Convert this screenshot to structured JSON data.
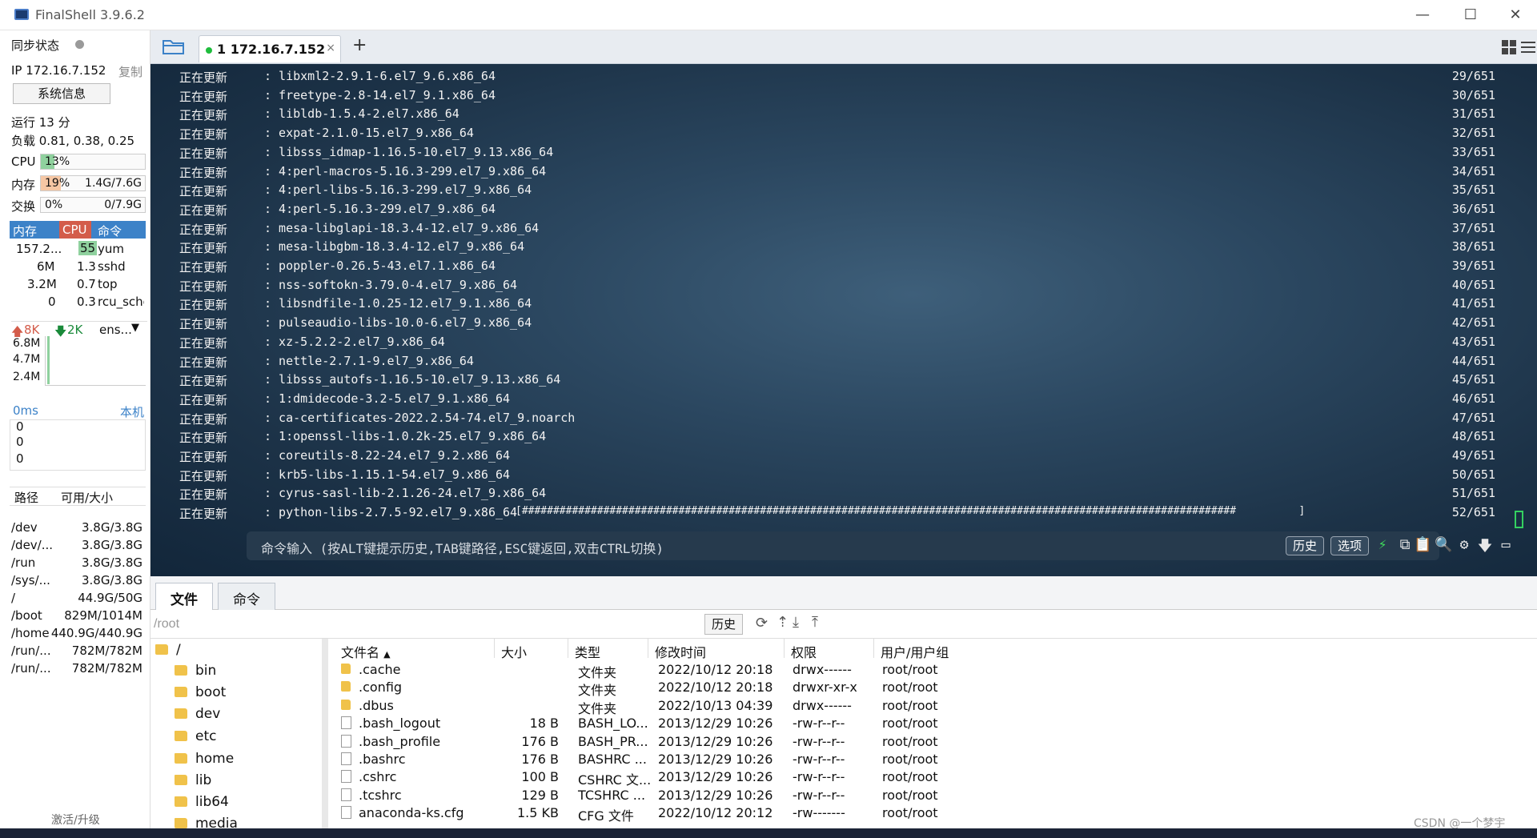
{
  "window": {
    "title": "FinalShell 3.9.6.2",
    "minimize": "—",
    "maximize": "☐",
    "close": "✕"
  },
  "sidebar": {
    "sync_label": "同步状态",
    "ip_label": "IP 172.16.7.152",
    "copy_label": "复制",
    "sysinfo_button": "系统信息",
    "uptime": "运行 13 分",
    "load": "负载 0.81, 0.38, 0.25",
    "cpu": {
      "label": "CPU",
      "value": "13%",
      "percent": 13
    },
    "mem": {
      "label": "内存",
      "value": "19%",
      "percent": 19,
      "amount": "1.4G/7.6G"
    },
    "swap": {
      "label": "交换",
      "value": "0%",
      "percent": 0,
      "amount": "0/7.9G"
    },
    "proc_headers": [
      "内存",
      "CPU",
      "命令"
    ],
    "procs": [
      {
        "mem": "157.2...",
        "cpu": "55",
        "cmd": "yum"
      },
      {
        "mem": "6M",
        "cpu": "1.3",
        "cmd": "sshd"
      },
      {
        "mem": "3.2M",
        "cpu": "0.7",
        "cmd": "top"
      },
      {
        "mem": "0",
        "cpu": "0.3",
        "cmd": "rcu_sche"
      }
    ],
    "net": {
      "up": "8K",
      "down": "2K",
      "iface": "ens...",
      "scale": [
        "6.8M",
        "4.7M",
        "2.4M"
      ]
    },
    "ping": {
      "latency": "0ms",
      "host": "本机",
      "values": [
        "0",
        "0",
        "0"
      ]
    },
    "disk_headers": [
      "路径",
      "可用/大小"
    ],
    "disks": [
      {
        "path": "/dev",
        "size": "3.8G/3.8G"
      },
      {
        "path": "/dev/...",
        "size": "3.8G/3.8G"
      },
      {
        "path": "/run",
        "size": "3.8G/3.8G"
      },
      {
        "path": "/sys/...",
        "size": "3.8G/3.8G"
      },
      {
        "path": "/",
        "size": "44.9G/50G"
      },
      {
        "path": "/boot",
        "size": "829M/1014M"
      },
      {
        "path": "/home",
        "size": "440.9G/440.9G"
      },
      {
        "path": "/run/...",
        "size": "782M/782M"
      },
      {
        "path": "/run/...",
        "size": "782M/782M"
      }
    ],
    "activate": "激活/升级"
  },
  "tabs": {
    "active_label": "1 172.16.7.152",
    "close": "×",
    "add": "+"
  },
  "terminal": {
    "lines": [
      {
        "status": "正在更新",
        "pkg": ": libxml2-2.9.1-6.el7_9.6.x86_64",
        "progress": "29/651"
      },
      {
        "status": "正在更新",
        "pkg": ": freetype-2.8-14.el7_9.1.x86_64",
        "progress": "30/651"
      },
      {
        "status": "正在更新",
        "pkg": ": libldb-1.5.4-2.el7.x86_64",
        "progress": "31/651"
      },
      {
        "status": "正在更新",
        "pkg": ": expat-2.1.0-15.el7_9.x86_64",
        "progress": "32/651"
      },
      {
        "status": "正在更新",
        "pkg": ": libsss_idmap-1.16.5-10.el7_9.13.x86_64",
        "progress": "33/651"
      },
      {
        "status": "正在更新",
        "pkg": ": 4:perl-macros-5.16.3-299.el7_9.x86_64",
        "progress": "34/651"
      },
      {
        "status": "正在更新",
        "pkg": ": 4:perl-libs-5.16.3-299.el7_9.x86_64",
        "progress": "35/651"
      },
      {
        "status": "正在更新",
        "pkg": ": 4:perl-5.16.3-299.el7_9.x86_64",
        "progress": "36/651"
      },
      {
        "status": "正在更新",
        "pkg": ": mesa-libglapi-18.3.4-12.el7_9.x86_64",
        "progress": "37/651"
      },
      {
        "status": "正在更新",
        "pkg": ": mesa-libgbm-18.3.4-12.el7_9.x86_64",
        "progress": "38/651"
      },
      {
        "status": "正在更新",
        "pkg": ": poppler-0.26.5-43.el7.1.x86_64",
        "progress": "39/651"
      },
      {
        "status": "正在更新",
        "pkg": ": nss-softokn-3.79.0-4.el7_9.x86_64",
        "progress": "40/651"
      },
      {
        "status": "正在更新",
        "pkg": ": libsndfile-1.0.25-12.el7_9.1.x86_64",
        "progress": "41/651"
      },
      {
        "status": "正在更新",
        "pkg": ": pulseaudio-libs-10.0-6.el7_9.x86_64",
        "progress": "42/651"
      },
      {
        "status": "正在更新",
        "pkg": ": xz-5.2.2-2.el7_9.x86_64",
        "progress": "43/651"
      },
      {
        "status": "正在更新",
        "pkg": ": nettle-2.7.1-9.el7_9.x86_64",
        "progress": "44/651"
      },
      {
        "status": "正在更新",
        "pkg": ": libsss_autofs-1.16.5-10.el7_9.13.x86_64",
        "progress": "45/651"
      },
      {
        "status": "正在更新",
        "pkg": ": 1:dmidecode-3.2-5.el7_9.1.x86_64",
        "progress": "46/651"
      },
      {
        "status": "正在更新",
        "pkg": ": ca-certificates-2022.2.54-74.el7_9.noarch",
        "progress": "47/651"
      },
      {
        "status": "正在更新",
        "pkg": ": 1:openssl-libs-1.0.2k-25.el7_9.x86_64",
        "progress": "48/651"
      },
      {
        "status": "正在更新",
        "pkg": ": coreutils-8.22-24.el7_9.2.x86_64",
        "progress": "49/651"
      },
      {
        "status": "正在更新",
        "pkg": ": krb5-libs-1.15.1-54.el7_9.x86_64",
        "progress": "50/651"
      },
      {
        "status": "正在更新",
        "pkg": ": cyrus-sasl-lib-2.1.26-24.el7_9.x86_64",
        "progress": "51/651"
      },
      {
        "status": "正在更新",
        "pkg": ": python-libs-2.7.5-92.el7_9.x86_64",
        "bar": "[##################################################################################################################          ]",
        "progress": "52/651"
      }
    ],
    "cmd_placeholder": "命令输入 (按ALT键提示历史,TAB键路径,ESC键返回,双击CTRL切换)",
    "history_btn": "历史",
    "options_btn": "选项"
  },
  "bottom": {
    "tabs": [
      "文件",
      "命令"
    ],
    "path": "/root",
    "history_btn": "历史",
    "tree": [
      {
        "name": "/",
        "level": 0
      },
      {
        "name": "bin",
        "level": 1
      },
      {
        "name": "boot",
        "level": 1
      },
      {
        "name": "dev",
        "level": 1
      },
      {
        "name": "etc",
        "level": 1
      },
      {
        "name": "home",
        "level": 1
      },
      {
        "name": "lib",
        "level": 1
      },
      {
        "name": "lib64",
        "level": 1
      },
      {
        "name": "media",
        "level": 1
      }
    ],
    "columns": [
      "文件名",
      "大小",
      "类型",
      "修改时间",
      "权限",
      "用户/用户组"
    ],
    "files": [
      {
        "name": ".cache",
        "size": "",
        "type": "文件夹",
        "mtime": "2022/10/12 20:18",
        "perm": "drwx------",
        "owner": "root/root",
        "dir": true
      },
      {
        "name": ".config",
        "size": "",
        "type": "文件夹",
        "mtime": "2022/10/12 20:18",
        "perm": "drwxr-xr-x",
        "owner": "root/root",
        "dir": true
      },
      {
        "name": ".dbus",
        "size": "",
        "type": "文件夹",
        "mtime": "2022/10/13 04:39",
        "perm": "drwx------",
        "owner": "root/root",
        "dir": true
      },
      {
        "name": ".bash_logout",
        "size": "18 B",
        "type": "BASH_LO...",
        "mtime": "2013/12/29 10:26",
        "perm": "-rw-r--r--",
        "owner": "root/root",
        "dir": false
      },
      {
        "name": ".bash_profile",
        "size": "176 B",
        "type": "BASH_PR...",
        "mtime": "2013/12/29 10:26",
        "perm": "-rw-r--r--",
        "owner": "root/root",
        "dir": false
      },
      {
        "name": ".bashrc",
        "size": "176 B",
        "type": "BASHRC ...",
        "mtime": "2013/12/29 10:26",
        "perm": "-rw-r--r--",
        "owner": "root/root",
        "dir": false
      },
      {
        "name": ".cshrc",
        "size": "100 B",
        "type": "CSHRC 文...",
        "mtime": "2013/12/29 10:26",
        "perm": "-rw-r--r--",
        "owner": "root/root",
        "dir": false
      },
      {
        "name": ".tcshrc",
        "size": "129 B",
        "type": "TCSHRC ...",
        "mtime": "2013/12/29 10:26",
        "perm": "-rw-r--r--",
        "owner": "root/root",
        "dir": false
      },
      {
        "name": "anaconda-ks.cfg",
        "size": "1.5 KB",
        "type": "CFG 文件",
        "mtime": "2022/10/12 20:12",
        "perm": "-rw-------",
        "owner": "root/root",
        "dir": false
      }
    ]
  },
  "watermark": "CSDN @一个梦宇",
  "colors": {
    "accent": "#3c82c8",
    "cpu_fill": "#8fd19e",
    "mem_fill": "#f6c7a4",
    "cpu_head": "#d35c4a",
    "online": "#1fbd3d"
  }
}
